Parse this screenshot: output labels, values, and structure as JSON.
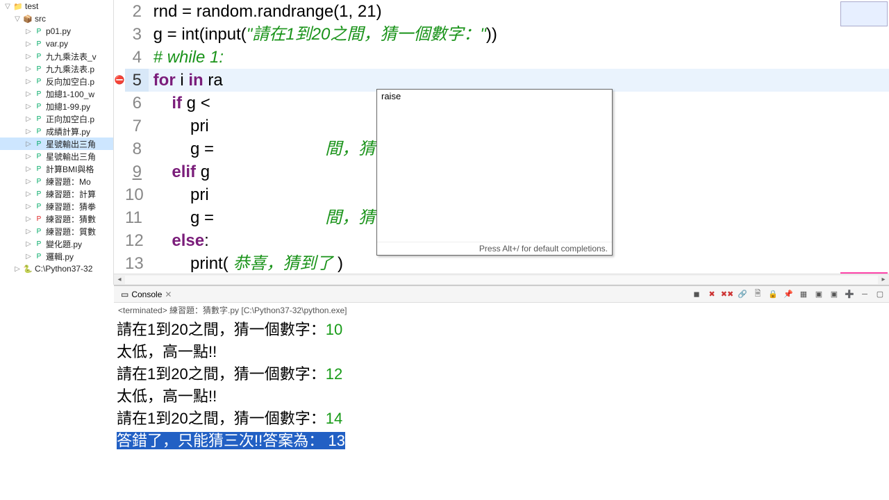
{
  "explorer": {
    "root": "test",
    "src": "src",
    "files": [
      "p01.py",
      "var.py",
      "九九乘法表_v",
      "九九乘法表.p",
      "反向加空白.p",
      "加總1-100_w",
      "加總1-99.py",
      "正向加空白.p",
      "成績計算.py",
      "星號輸出三角",
      "星號輸出三角",
      "計算BMI與格",
      "練習題：Mo",
      "練習題：計算",
      "練習題：猜拳",
      "練習題：猜數",
      "練習題：質數",
      "變化題.py",
      "邏輯.py"
    ],
    "err_file_index": 15,
    "sel_file_index": 9,
    "python": "C:\\Python37-32"
  },
  "editor": {
    "lines": [
      {
        "n": 2,
        "mark": "",
        "cur": false,
        "mod": false,
        "txt": "rnd = random.randrange(<n>1</n>, <n>21</n>)"
      },
      {
        "n": 3,
        "mark": "",
        "cur": false,
        "mod": false,
        "txt": "g = <fn>int</fn>(<fn>input</fn>(<s>\"請在1到20之間，猜一個數字：\"</s>))"
      },
      {
        "n": 4,
        "mark": "",
        "cur": false,
        "mod": false,
        "txt": "<c># while 1:</c>"
      },
      {
        "n": 5,
        "mark": "err",
        "cur": true,
        "mod": false,
        "txt": "<k>for</k> i <k>in</k> ra"
      },
      {
        "n": 6,
        "mark": "",
        "cur": false,
        "mod": false,
        "txt": "    <k>if</k> g < "
      },
      {
        "n": 7,
        "mark": "",
        "cur": false,
        "mod": false,
        "txt": "        pri"
      },
      {
        "n": 8,
        "mark": "",
        "cur": false,
        "mod": false,
        "txt": "        g =                        <s>間，猜一個數字：\"</s>))"
      },
      {
        "n": 9,
        "mark": "",
        "cur": false,
        "mod": true,
        "txt": "    <k>elif</k> g "
      },
      {
        "n": 10,
        "mark": "",
        "cur": false,
        "mod": false,
        "txt": "        pri"
      },
      {
        "n": 11,
        "mark": "",
        "cur": false,
        "mod": false,
        "txt": "        g =                        <s>間，猜一個數字：\"</s>))"
      },
      {
        "n": 12,
        "mark": "",
        "cur": false,
        "mod": false,
        "txt": "    <k>else</k>:"
      },
      {
        "n": 13,
        "mark": "",
        "cur": false,
        "mod": false,
        "txt": "        <fn>print</fn>( <s>恭喜，猜到了</s> )"
      }
    ]
  },
  "popup": {
    "item": "raise",
    "hint": "Press Alt+/ for default completions."
  },
  "console": {
    "tab": "Console",
    "status": "<terminated> 練習題：猜數字.py [C:\\Python37-32\\python.exe]",
    "lines": [
      {
        "t": "請在1到20之間，猜一個數字：",
        "in": "10",
        "sel": false
      },
      {
        "t": "太低，高一點!!",
        "in": "",
        "sel": false
      },
      {
        "t": "請在1到20之間，猜一個數字：",
        "in": "12",
        "sel": false
      },
      {
        "t": "太低，高一點!!",
        "in": "",
        "sel": false
      },
      {
        "t": "請在1到20之間，猜一個數字：",
        "in": "14",
        "sel": false
      },
      {
        "t": "答錯了，只能猜三次!!答案為： ",
        "in": "13",
        "sel": true
      }
    ]
  }
}
